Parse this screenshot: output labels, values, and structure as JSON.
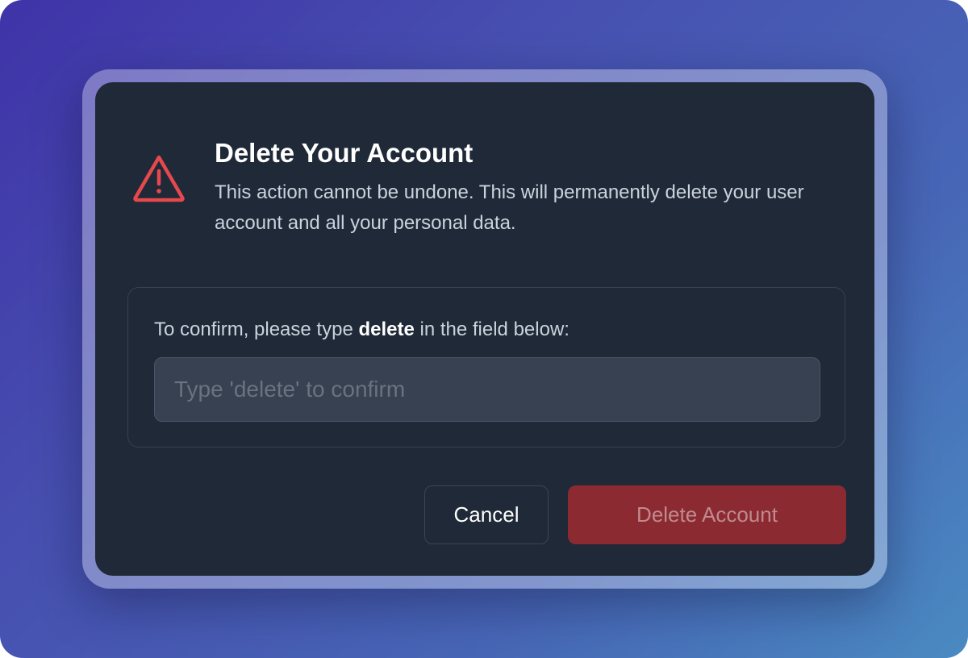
{
  "dialog": {
    "title": "Delete Your Account",
    "description": "This action cannot be undone. This will permanently delete your user account and all your personal data.",
    "icon": "warning-triangle-icon"
  },
  "confirm": {
    "label_prefix": "To confirm, please type ",
    "label_keyword": "delete",
    "label_suffix": " in the field below:",
    "input_value": "",
    "input_placeholder": "Type 'delete' to confirm"
  },
  "actions": {
    "cancel_label": "Cancel",
    "delete_label": "Delete Account"
  },
  "colors": {
    "danger": "#e5484d",
    "danger_button": "#8b2a31",
    "modal_bg": "#1f2937"
  }
}
